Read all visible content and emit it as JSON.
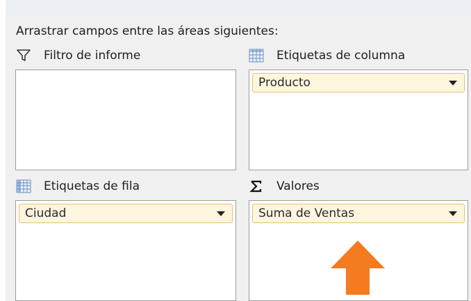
{
  "instructions": "Arrastrar campos entre las áreas siguientes:",
  "areas": {
    "report_filter": {
      "title": "Filtro de informe",
      "icon": "funnel-icon"
    },
    "column_labels": {
      "title": "Etiquetas de columna",
      "icon": "table-grid-icon",
      "field": "Producto"
    },
    "row_labels": {
      "title": "Etiquetas de fila",
      "icon": "table-grid-icon",
      "field": "Ciudad"
    },
    "values": {
      "title": "Valores",
      "icon": "sigma-icon",
      "field": "Suma de Ventas"
    }
  },
  "annotation": {
    "icon": "up-arrow-icon",
    "color": "#f47b20"
  },
  "colors": {
    "field_fill": "#fdf5dd",
    "field_border": "#e3c272",
    "panel_bg": "#f0f0f0"
  }
}
